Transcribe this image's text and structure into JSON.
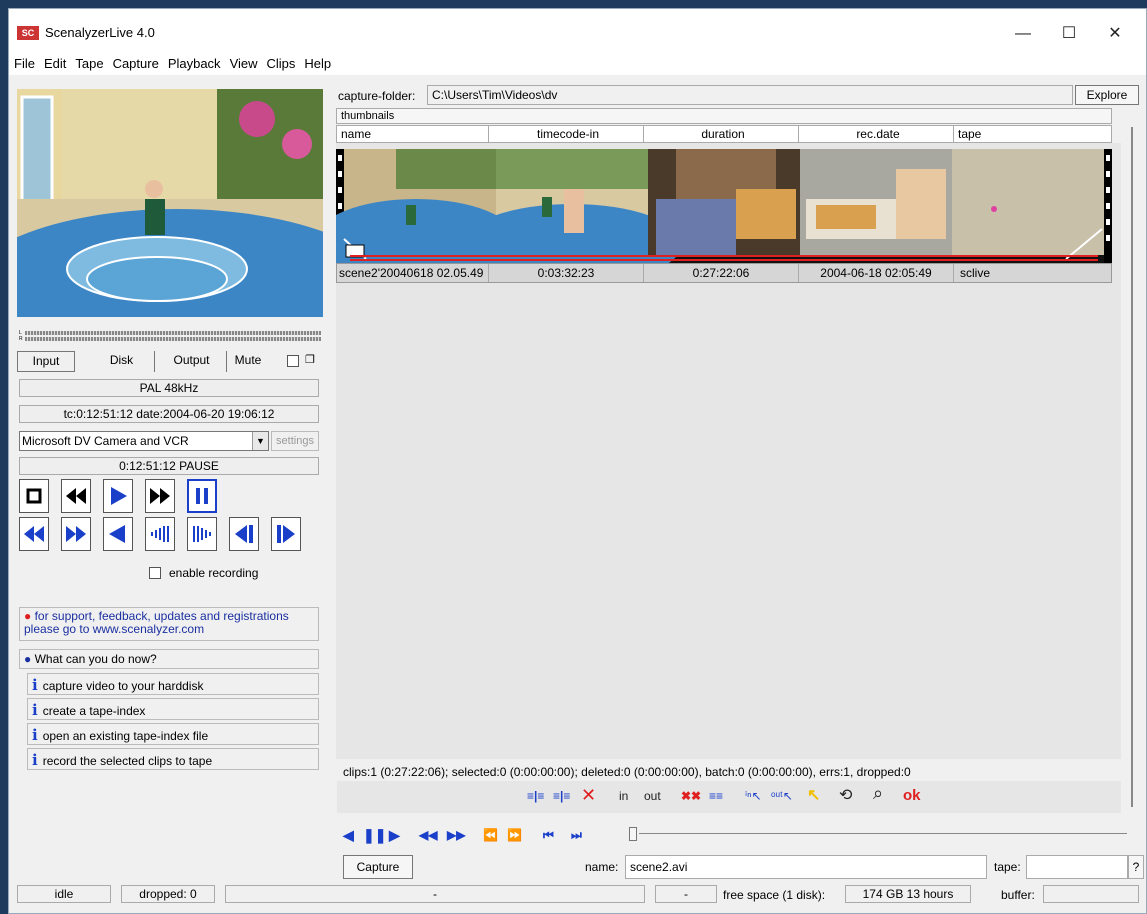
{
  "window": {
    "title": "ScenalyzerLive 4.0",
    "minimize": "—",
    "maximize": "☐",
    "close": "✕"
  },
  "menu": [
    "File",
    "Edit",
    "Tape",
    "Capture",
    "Playback",
    "View",
    "Clips",
    "Help"
  ],
  "vu": {
    "left": "L",
    "right": "R"
  },
  "source_tabs": {
    "input": "Input",
    "disk": "Disk",
    "output": "Output",
    "mute": "Mute"
  },
  "audio_format": "PAL 48kHz",
  "timecode_info": "tc:0:12:51:12  date:2004-06-20 19:06:12",
  "device": {
    "selected": "Microsoft DV Camera and VCR",
    "settings": "settings"
  },
  "transport_status": "0:12:51:12 PAUSE",
  "enable_recording": "enable recording",
  "hints": {
    "support": "for support, feedback, updates and registrations please go to www.scenalyzer.com",
    "what_now": "What can you do now?",
    "items": [
      "capture video to your harddisk",
      "create a tape-index",
      "open an existing tape-index file",
      "record the selected clips to tape"
    ]
  },
  "capture_folder": {
    "label": "capture-folder:",
    "path": "C:\\Users\\Tim\\Videos\\dv",
    "explore": "Explore"
  },
  "thumbnails_tab": "thumbnails",
  "columns": [
    "name",
    "timecode-in",
    "duration",
    "rec.date",
    "tape"
  ],
  "clip": {
    "name": "scene2'20040618 02.05.49",
    "timecode_in": "0:03:32:23",
    "duration": "0:27:22:06",
    "rec_date": "2004-06-18 02:05:49",
    "tape": "sclive"
  },
  "stats": "clips:1 (0:27:22:06); selected:0 (0:00:00:00); deleted:0 (0:00:00:00), batch:0 (0:00:00:00), errs:1, dropped:0",
  "edit_toolbar": {
    "in": "in",
    "out": "out",
    "ok": "ok"
  },
  "capture_button": "Capture",
  "name_field": {
    "label": "name:",
    "value": "scene2.avi"
  },
  "tape_field": {
    "label": "tape:",
    "value": ""
  },
  "help_button": "?",
  "status": {
    "state": "idle",
    "dropped": "dropped: 0",
    "mid": "-",
    "mid2": "-",
    "free_space_label": "free space (1 disk):",
    "free_space_value": "174 GB 13 hours",
    "buffer": "buffer:"
  },
  "colors": {
    "accent_blue": "#1a3fc9",
    "red": "#e02020",
    "window_bg": "#f0f0f0"
  }
}
